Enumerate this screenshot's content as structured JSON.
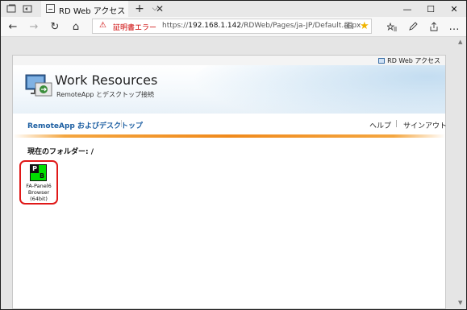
{
  "browser": {
    "tab_title": "RD Web アクセス",
    "tab_close": "✕",
    "new_tab": "+",
    "tab_menu": "⌵",
    "window_controls": {
      "minimize": "—",
      "maximize": "☐",
      "close": "✕"
    },
    "nav": {
      "back": "←",
      "forward": "→",
      "refresh": "↻",
      "home": "⌂"
    },
    "address": {
      "cert_error": "証明書エラー",
      "url_scheme": "https://",
      "url_host": "192.168.1.142",
      "url_path": "/RDWeb/Pages/ja-JP/Default.aspx"
    },
    "toolbar_icons": [
      "favorites-list-icon",
      "pen-icon",
      "share-icon",
      "more-icon"
    ]
  },
  "page": {
    "top_label": "RD Web アクセス",
    "banner_title": "Work Resources",
    "banner_subtitle": "RemoteApp とデスクトップ接続",
    "menu": {
      "remoteapp": "RemoteApp およびデスクトップ",
      "sep": "|",
      "help": "ヘルプ",
      "signout": "サインアウト"
    },
    "current_folder": "現在のフォルダー: /",
    "apps": [
      {
        "icon_top": "P",
        "icon_bottom": "B",
        "label_line1": "FA-Panel6",
        "label_line2": "Browser",
        "label_line3": "(64bit)"
      }
    ]
  },
  "colors": {
    "accent_link": "#1d5fa2",
    "cert_error": "#cc0000",
    "orange_rule": "#f08a1c",
    "highlight_outline": "#e01818",
    "app_icon_green": "#00e000"
  }
}
